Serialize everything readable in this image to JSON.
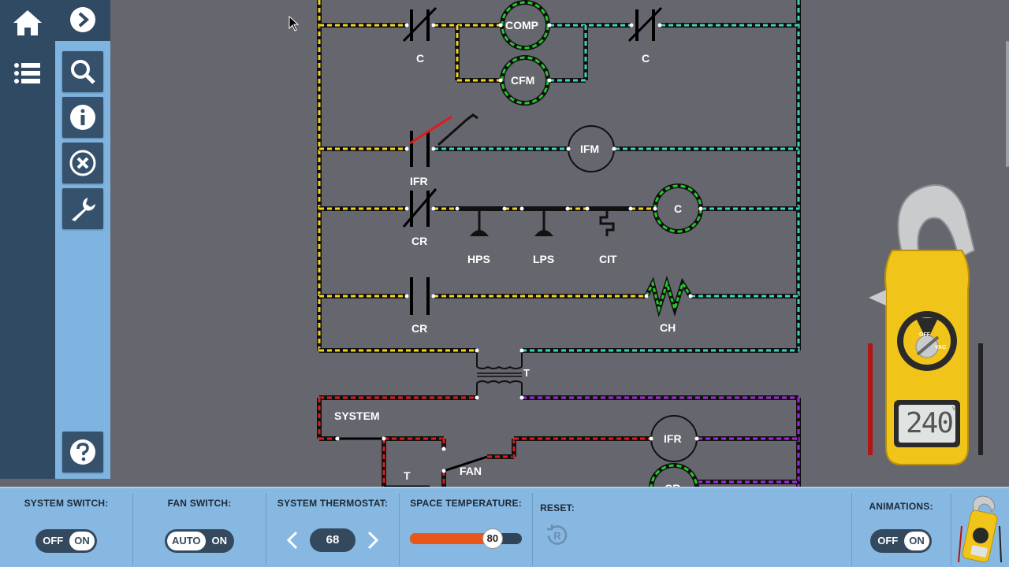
{
  "schematic": {
    "components": [
      "COMP",
      "CFM",
      "IFM",
      "C",
      "IFR",
      "CR"
    ],
    "labels": [
      "C",
      "C",
      "IFR",
      "CR",
      "HPS",
      "LPS",
      "CIT",
      "CR",
      "CH",
      "T",
      "SYSTEM",
      "FAN",
      "T"
    ]
  },
  "meter": {
    "reading": "240",
    "unit": "V",
    "dial_off": "OFF",
    "dial_vac": "VAC"
  },
  "controls": {
    "system_switch": {
      "title": "SYSTEM SWITCH:",
      "off": "OFF",
      "on": "ON",
      "selected": "ON"
    },
    "fan_switch": {
      "title": "FAN SWITCH:",
      "auto": "AUTO",
      "on": "ON",
      "selected": "AUTO"
    },
    "thermostat": {
      "title": "SYSTEM THERMOSTAT:",
      "value": "68"
    },
    "space_temp": {
      "title": "SPACE TEMPERATURE:",
      "value": "80",
      "fill_fraction": 0.64
    },
    "reset": {
      "title": "RESET:"
    },
    "animations": {
      "title": "ANIMATIONS:",
      "off": "OFF",
      "on": "ON",
      "selected": "ON"
    }
  },
  "colors": {
    "line_yellow": "#f2d21b",
    "line_cyan": "#3fd1c0",
    "line_red": "#e01b1b",
    "line_purple": "#a02bd6",
    "component_green": "#24c92a",
    "nav_dark": "#2f4a62",
    "panel_blue": "#7fb4e0",
    "slider_orange": "#e8561a"
  }
}
